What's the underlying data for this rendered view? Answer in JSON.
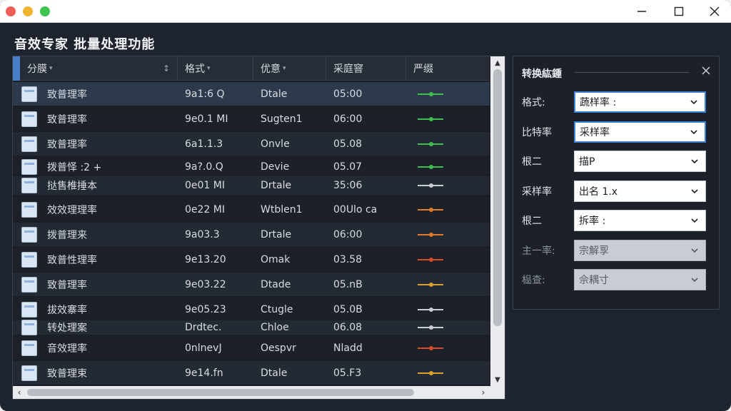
{
  "window": {
    "title": "音效专家 批量处理功能"
  },
  "table": {
    "columns": [
      {
        "label": "分膜",
        "sort": "▾",
        "pin": "↕"
      },
      {
        "label": "格式",
        "sort": "▾"
      },
      {
        "label": "优意",
        "sort": "▾"
      },
      {
        "label": "采庭窨"
      },
      {
        "label": "严缀"
      }
    ],
    "rows": [
      {
        "name": "致普理率",
        "format": "9a1:6 Q",
        "info": "Dtale",
        "rate": "05:00",
        "wave_color": "#3fbf4f"
      },
      {
        "name": "致普理率",
        "format": "9e0.1 MI",
        "info": "Sugten1",
        "rate": "06:00",
        "wave_color": "#3fbf4f"
      },
      {
        "name": "致普理率",
        "format": "6a1.1.3",
        "info": "Onvle",
        "rate": "05.08",
        "wave_color": "#3fbf4f"
      },
      {
        "name": "拨普怿 :2 +",
        "format": "9a?.0.Q",
        "info": "Devie",
        "rate": "05.07",
        "wave_color": "#3fbf4f"
      },
      {
        "name": "挞售椎捶本",
        "format": "0e01 MI",
        "info": "Drtale",
        "rate": "35:06",
        "wave_color": "#c9ced6"
      },
      {
        "name": "效效理理率",
        "format": "0e22 MI",
        "info": "Wtblen1",
        "rate": "00Ulo ca",
        "wave_color": "#e07b2a"
      },
      {
        "name": "拨普理来",
        "format": "9a03.3",
        "info": "Drtale",
        "rate": "06:00",
        "wave_color": "#e07b2a"
      },
      {
        "name": "致普性理率",
        "format": "9e13.20",
        "info": "Omak",
        "rate": "03.58",
        "wave_color": "#d94a2b"
      },
      {
        "name": "致普理率",
        "format": "9e03.22",
        "info": "Dtade",
        "rate": "05.nB",
        "wave_color": "#d9a02b"
      },
      {
        "name": "拔效寨率",
        "format": "9e05.23",
        "info": "Ctugle",
        "rate": "05.0B",
        "wave_color": "#c9ced6"
      },
      {
        "name": "转处理案",
        "format": "Drdtec.",
        "info": "Chloe",
        "rate": "06.08",
        "wave_color": "#c9ced6"
      },
      {
        "name": "音效理率",
        "format": "0nlnevJ",
        "info": "Oespvr",
        "rate": "Nladd",
        "wave_color": "#d94a2b"
      },
      {
        "name": "致普理束",
        "format": "9e14.fn",
        "info": "Dtale",
        "rate": "05.F3",
        "wave_color": "#d9a02b"
      }
    ]
  },
  "panel": {
    "title": "转换紘鍾",
    "fields": [
      {
        "label": "格式:",
        "value": "蔬样率 :",
        "state": "focus"
      },
      {
        "label": "比特率",
        "value": "采样率",
        "state": "focus"
      },
      {
        "label": "根二",
        "value": "描P",
        "state": "normal"
      },
      {
        "label": "采样率",
        "value": "出名 1.x",
        "state": "normal"
      },
      {
        "label": "根二",
        "value": "拆率 :",
        "state": "normal"
      },
      {
        "label": "主一率:",
        "value": "宗解孠",
        "state": "disabled"
      },
      {
        "label": "榀查:",
        "value": "佘耦寸",
        "state": "disabled"
      }
    ]
  },
  "colors": {
    "window_bg": "#1e242d",
    "selected_row": "#2c3a4c",
    "focus_border": "#3b7fd6"
  }
}
